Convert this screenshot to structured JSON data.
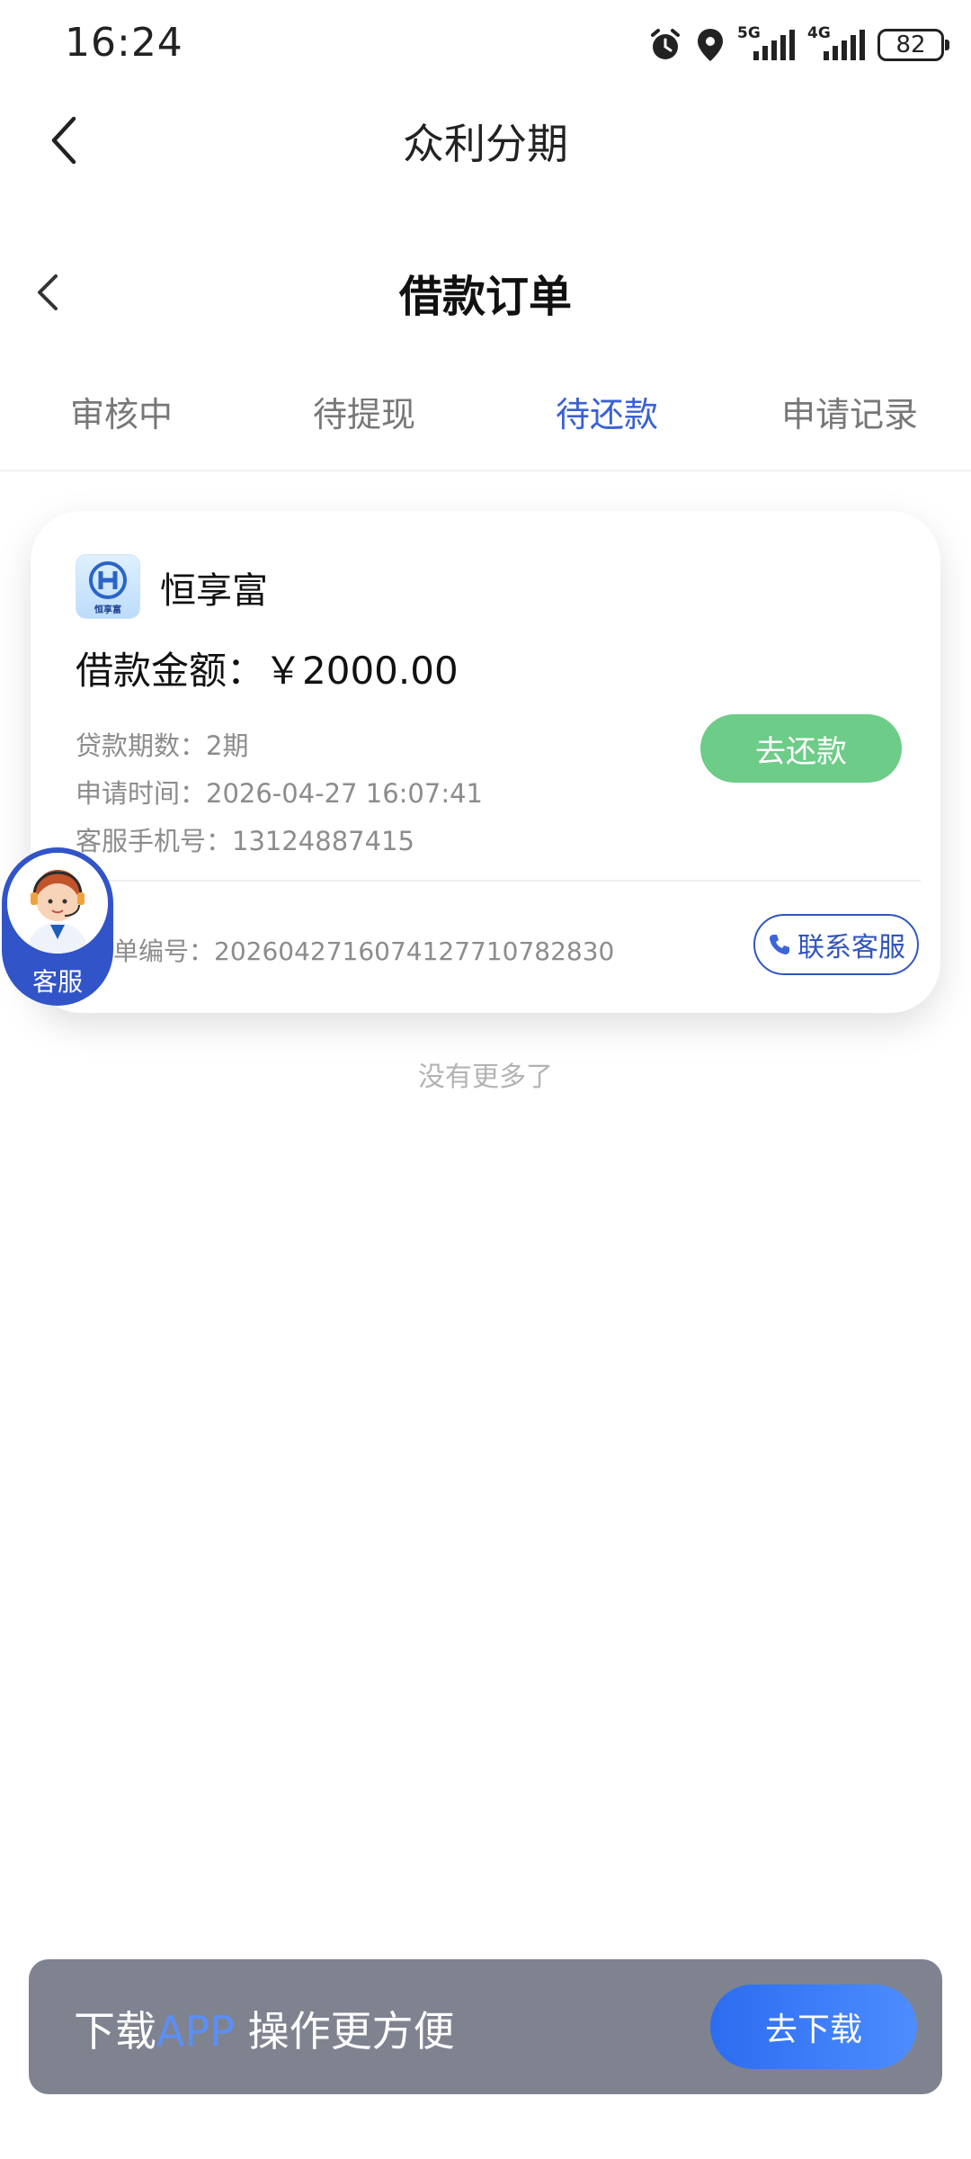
{
  "status_bar": {
    "time": "16:24",
    "icons": [
      "alarm-icon",
      "location-icon",
      "signal-5g-icon",
      "signal-4g-icon",
      "battery-icon"
    ],
    "signal_5g": "5G",
    "signal_4g": "4G",
    "battery": "82"
  },
  "header": {
    "app_title": "众利分期",
    "page_title": "借款订单"
  },
  "tabs": [
    {
      "label": "审核中",
      "active": false
    },
    {
      "label": "待提现",
      "active": false
    },
    {
      "label": "待还款",
      "active": true
    },
    {
      "label": "申请记录",
      "active": false
    }
  ],
  "order_card": {
    "lender_name": "恒享富",
    "logo_text": "恒享富",
    "amount": "借款金额：￥2000.00",
    "term": "贷款期数：2期",
    "apply_time": "申请时间：2026-04-27 16:07:41",
    "service_phone": "客服手机号：13124887415",
    "repay_button": "去还款",
    "order_number": "单编号：20260427160741277107828​30",
    "contact_button": "联系客服"
  },
  "floating_support": {
    "label": "客服"
  },
  "list_end_text": "没有更多了",
  "download_banner": {
    "prefix": "下载",
    "app": "APP",
    "suffix": " 操作更方便",
    "button": "去下载"
  },
  "colors": {
    "accent": "#3860d6",
    "repay_green": "#6dcc87",
    "support_blue": "#3154c9",
    "banner_gray": "#7f8390",
    "download_blue": "#2c6cf0"
  }
}
